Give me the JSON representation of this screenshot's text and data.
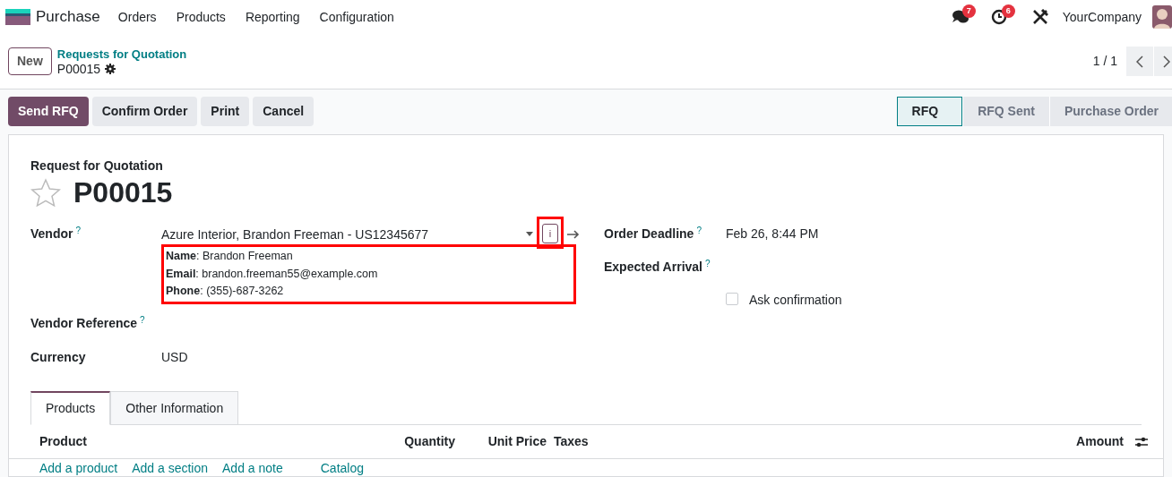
{
  "app": {
    "name": "Purchase",
    "menu": [
      "Orders",
      "Products",
      "Reporting",
      "Configuration"
    ]
  },
  "systray": {
    "messages_badge": "7",
    "activities_badge": "6",
    "company": "YourCompany"
  },
  "control": {
    "new_button": "New",
    "breadcrumb": "Requests for Quotation",
    "record": "P00015",
    "pager": "1 / 1"
  },
  "actions": [
    {
      "label": "Send RFQ",
      "primary": true
    },
    {
      "label": "Confirm Order",
      "primary": false
    },
    {
      "label": "Print",
      "primary": false
    },
    {
      "label": "Cancel",
      "primary": false
    }
  ],
  "status_steps": [
    {
      "label": "RFQ",
      "selected": true
    },
    {
      "label": "RFQ Sent",
      "selected": false
    },
    {
      "label": "Purchase Order",
      "selected": false
    }
  ],
  "form": {
    "subtitle": "Request for Quotation",
    "name": "P00015",
    "starred": false,
    "left_fields": [
      {
        "kind": "vendor",
        "label": "Vendor",
        "help": "?",
        "value": "Azure Interior, Brandon Freeman - US12345677",
        "info_button": "i",
        "info_lines": [
          "**Name**: Brandon Freeman",
          "**Email**: brandon.freeman55@example.com",
          "**Phone**: (355)-687-3262"
        ]
      },
      {
        "kind": "text",
        "label": "Vendor Reference",
        "help": "?"
      },
      {
        "kind": "text",
        "label": "Currency",
        "value": "USD"
      }
    ],
    "right_fields": [
      {
        "kind": "text",
        "label": "Order Deadline",
        "help": "?",
        "value": "Feb 26, 8:44 PM"
      },
      {
        "kind": "text",
        "label": "Expected Arrival",
        "help": "?"
      },
      {
        "kind": "checkbox",
        "value": "Ask confirmation",
        "checked": false
      }
    ]
  },
  "tabs": [
    {
      "label": "Products",
      "selected": true
    },
    {
      "label": "Other Information",
      "selected": false
    }
  ],
  "table": {
    "columns": [
      "Product",
      "Quantity",
      "Unit Price",
      "Taxes",
      "Amount"
    ]
  },
  "row_actions": [
    "Add a product",
    "Add a section",
    "Add a note",
    "Catalog"
  ]
}
